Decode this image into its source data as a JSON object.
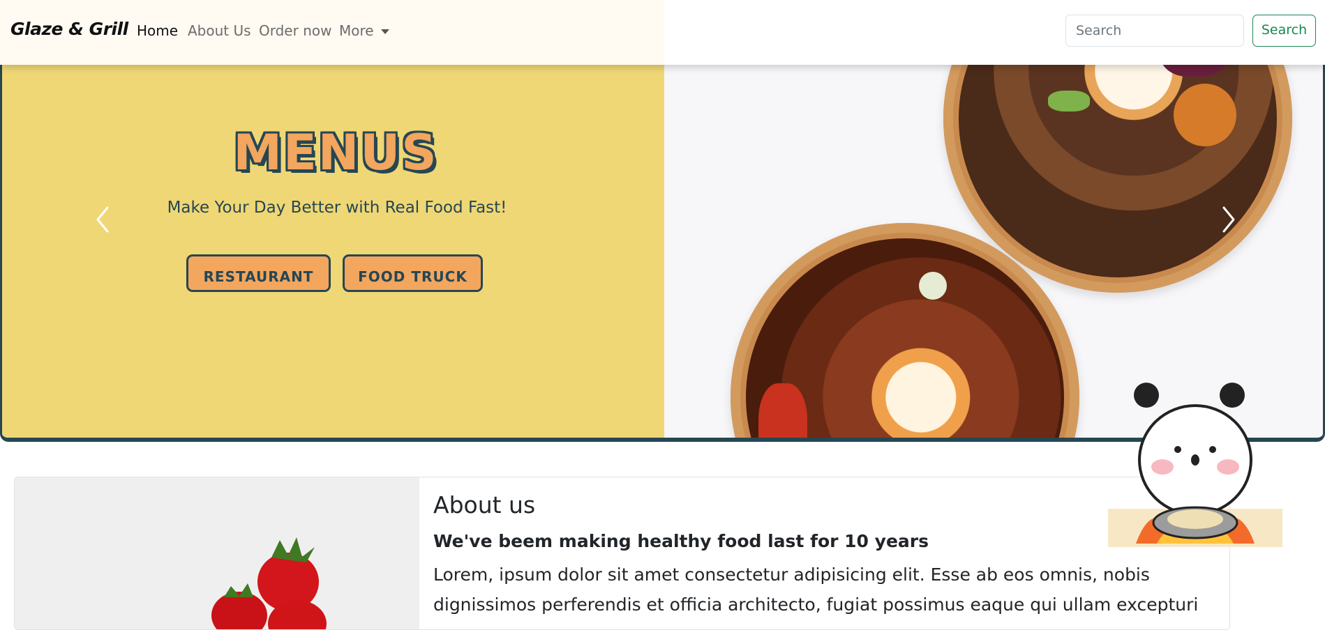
{
  "navbar": {
    "brand": "Glaze & Grill",
    "links": [
      {
        "label": "Home",
        "active": true
      },
      {
        "label": "About Us",
        "active": false
      },
      {
        "label": "Order now",
        "active": false
      },
      {
        "label": "More",
        "active": false,
        "dropdown": true
      }
    ],
    "search": {
      "placeholder": "Search",
      "button_label": "Search"
    }
  },
  "hero": {
    "title": "MENUS",
    "tagline": "Make Your Day Better with Real Food Fast!",
    "buttons": [
      "RESTAURANT",
      "FOOD TRUCK"
    ],
    "colors": {
      "left_bg": "#efd775",
      "accent": "#f2a65e",
      "dark": "#264653"
    }
  },
  "about": {
    "title": "About us",
    "subtitle": "We've beem making healthy food last for 10 years",
    "body": "Lorem, ipsum dolor sit amet consectetur adipisicing elit. Esse ab eos omnis, nobis dignissimos perferendis et officia architecto, fugiat possimus eaque qui ullam excepturi"
  },
  "icons": [
    "chevron-left-icon",
    "chevron-right-icon",
    "caret-down-icon",
    "panda-mascot"
  ]
}
